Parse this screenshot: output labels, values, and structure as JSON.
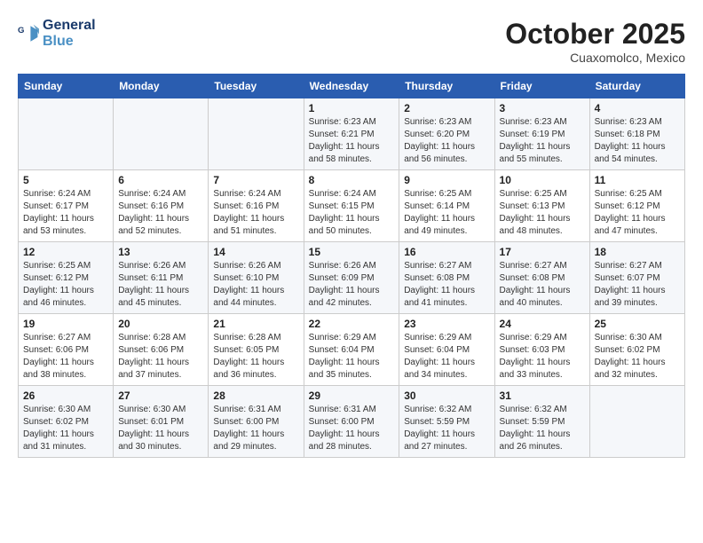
{
  "header": {
    "logo_line1": "General",
    "logo_line2": "Blue",
    "month": "October 2025",
    "location": "Cuaxomolco, Mexico"
  },
  "weekdays": [
    "Sunday",
    "Monday",
    "Tuesday",
    "Wednesday",
    "Thursday",
    "Friday",
    "Saturday"
  ],
  "weeks": [
    [
      null,
      null,
      null,
      {
        "day": 1,
        "sunrise": "6:23 AM",
        "sunset": "6:21 PM",
        "daylight": "11 hours and 58 minutes."
      },
      {
        "day": 2,
        "sunrise": "6:23 AM",
        "sunset": "6:20 PM",
        "daylight": "11 hours and 56 minutes."
      },
      {
        "day": 3,
        "sunrise": "6:23 AM",
        "sunset": "6:19 PM",
        "daylight": "11 hours and 55 minutes."
      },
      {
        "day": 4,
        "sunrise": "6:23 AM",
        "sunset": "6:18 PM",
        "daylight": "11 hours and 54 minutes."
      }
    ],
    [
      {
        "day": 5,
        "sunrise": "6:24 AM",
        "sunset": "6:17 PM",
        "daylight": "11 hours and 53 minutes."
      },
      {
        "day": 6,
        "sunrise": "6:24 AM",
        "sunset": "6:16 PM",
        "daylight": "11 hours and 52 minutes."
      },
      {
        "day": 7,
        "sunrise": "6:24 AM",
        "sunset": "6:16 PM",
        "daylight": "11 hours and 51 minutes."
      },
      {
        "day": 8,
        "sunrise": "6:24 AM",
        "sunset": "6:15 PM",
        "daylight": "11 hours and 50 minutes."
      },
      {
        "day": 9,
        "sunrise": "6:25 AM",
        "sunset": "6:14 PM",
        "daylight": "11 hours and 49 minutes."
      },
      {
        "day": 10,
        "sunrise": "6:25 AM",
        "sunset": "6:13 PM",
        "daylight": "11 hours and 48 minutes."
      },
      {
        "day": 11,
        "sunrise": "6:25 AM",
        "sunset": "6:12 PM",
        "daylight": "11 hours and 47 minutes."
      }
    ],
    [
      {
        "day": 12,
        "sunrise": "6:25 AM",
        "sunset": "6:12 PM",
        "daylight": "11 hours and 46 minutes."
      },
      {
        "day": 13,
        "sunrise": "6:26 AM",
        "sunset": "6:11 PM",
        "daylight": "11 hours and 45 minutes."
      },
      {
        "day": 14,
        "sunrise": "6:26 AM",
        "sunset": "6:10 PM",
        "daylight": "11 hours and 44 minutes."
      },
      {
        "day": 15,
        "sunrise": "6:26 AM",
        "sunset": "6:09 PM",
        "daylight": "11 hours and 42 minutes."
      },
      {
        "day": 16,
        "sunrise": "6:27 AM",
        "sunset": "6:08 PM",
        "daylight": "11 hours and 41 minutes."
      },
      {
        "day": 17,
        "sunrise": "6:27 AM",
        "sunset": "6:08 PM",
        "daylight": "11 hours and 40 minutes."
      },
      {
        "day": 18,
        "sunrise": "6:27 AM",
        "sunset": "6:07 PM",
        "daylight": "11 hours and 39 minutes."
      }
    ],
    [
      {
        "day": 19,
        "sunrise": "6:27 AM",
        "sunset": "6:06 PM",
        "daylight": "11 hours and 38 minutes."
      },
      {
        "day": 20,
        "sunrise": "6:28 AM",
        "sunset": "6:06 PM",
        "daylight": "11 hours and 37 minutes."
      },
      {
        "day": 21,
        "sunrise": "6:28 AM",
        "sunset": "6:05 PM",
        "daylight": "11 hours and 36 minutes."
      },
      {
        "day": 22,
        "sunrise": "6:29 AM",
        "sunset": "6:04 PM",
        "daylight": "11 hours and 35 minutes."
      },
      {
        "day": 23,
        "sunrise": "6:29 AM",
        "sunset": "6:04 PM",
        "daylight": "11 hours and 34 minutes."
      },
      {
        "day": 24,
        "sunrise": "6:29 AM",
        "sunset": "6:03 PM",
        "daylight": "11 hours and 33 minutes."
      },
      {
        "day": 25,
        "sunrise": "6:30 AM",
        "sunset": "6:02 PM",
        "daylight": "11 hours and 32 minutes."
      }
    ],
    [
      {
        "day": 26,
        "sunrise": "6:30 AM",
        "sunset": "6:02 PM",
        "daylight": "11 hours and 31 minutes."
      },
      {
        "day": 27,
        "sunrise": "6:30 AM",
        "sunset": "6:01 PM",
        "daylight": "11 hours and 30 minutes."
      },
      {
        "day": 28,
        "sunrise": "6:31 AM",
        "sunset": "6:00 PM",
        "daylight": "11 hours and 29 minutes."
      },
      {
        "day": 29,
        "sunrise": "6:31 AM",
        "sunset": "6:00 PM",
        "daylight": "11 hours and 28 minutes."
      },
      {
        "day": 30,
        "sunrise": "6:32 AM",
        "sunset": "5:59 PM",
        "daylight": "11 hours and 27 minutes."
      },
      {
        "day": 31,
        "sunrise": "6:32 AM",
        "sunset": "5:59 PM",
        "daylight": "11 hours and 26 minutes."
      },
      null
    ]
  ]
}
